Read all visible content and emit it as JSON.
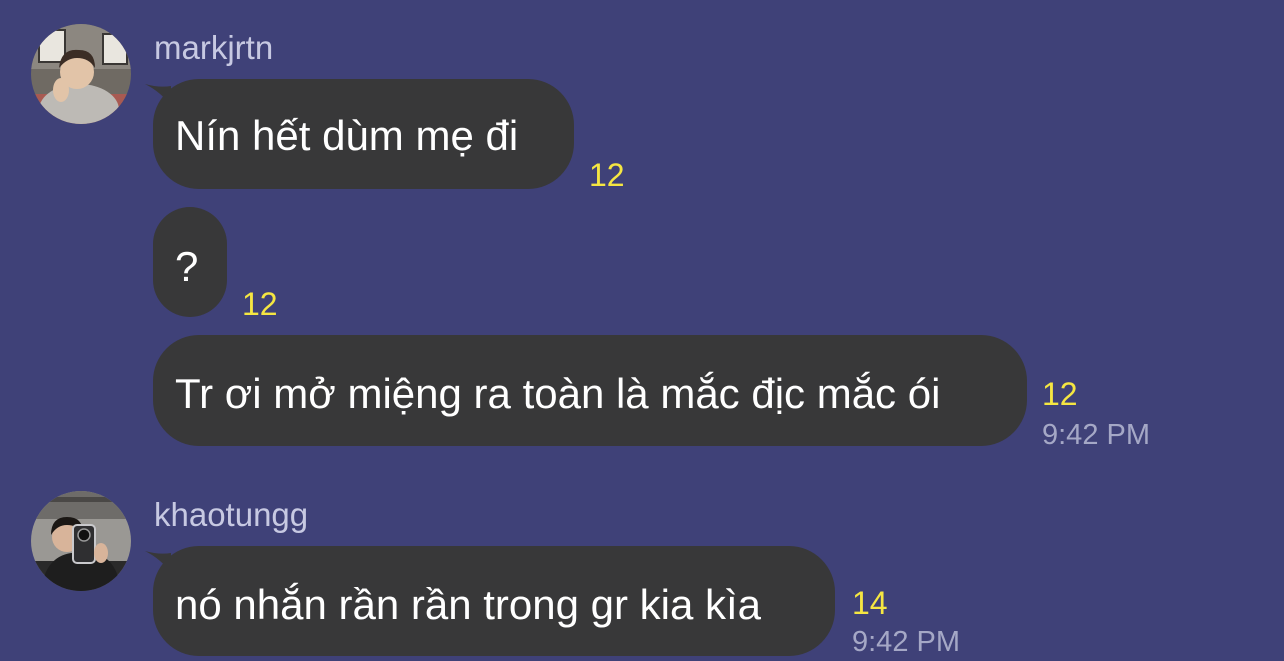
{
  "colors": {
    "background": "#3f4178",
    "bubble": "#383839",
    "bubble_text": "#ffffff",
    "username": "#c7c9e2",
    "read_count": "#f5e642",
    "timestamp": "#a5a8c6"
  },
  "groups": [
    {
      "username": "markjrtn",
      "avatar_icon": "user-avatar-photo",
      "messages": [
        {
          "text": "Nín hết dùm mẹ đi",
          "read_count": "12",
          "time": ""
        },
        {
          "text": "?",
          "read_count": "12",
          "time": ""
        },
        {
          "text": "Tr ơi mở miệng ra toàn là mắc địc mắc ói",
          "read_count": "12",
          "time": "9:42 PM"
        }
      ]
    },
    {
      "username": "khaotungg",
      "avatar_icon": "user-avatar-photo",
      "messages": [
        {
          "text": "nó nhắn rần rần trong gr kia kìa",
          "read_count": "14",
          "time": "9:42 PM"
        }
      ]
    }
  ]
}
